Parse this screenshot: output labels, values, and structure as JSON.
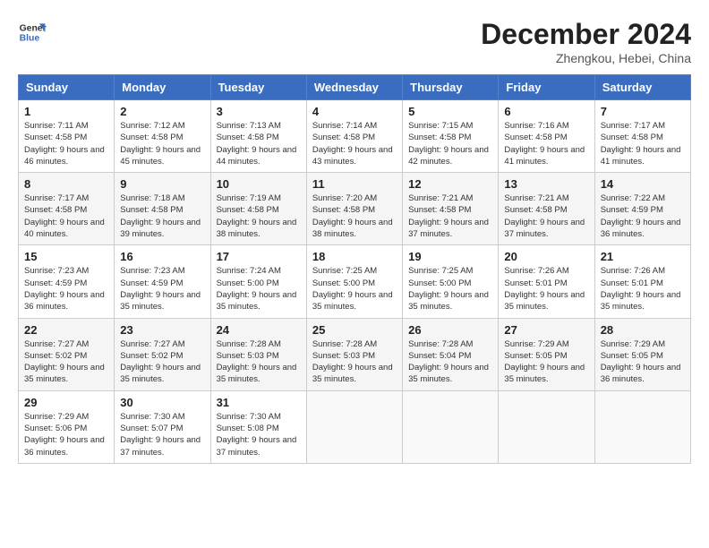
{
  "header": {
    "logo_line1": "General",
    "logo_line2": "Blue",
    "month": "December 2024",
    "location": "Zhengkou, Hebei, China"
  },
  "days_of_week": [
    "Sunday",
    "Monday",
    "Tuesday",
    "Wednesday",
    "Thursday",
    "Friday",
    "Saturday"
  ],
  "weeks": [
    [
      {
        "day": "1",
        "sunrise": "7:11 AM",
        "sunset": "4:58 PM",
        "daylight": "9 hours and 46 minutes."
      },
      {
        "day": "2",
        "sunrise": "7:12 AM",
        "sunset": "4:58 PM",
        "daylight": "9 hours and 45 minutes."
      },
      {
        "day": "3",
        "sunrise": "7:13 AM",
        "sunset": "4:58 PM",
        "daylight": "9 hours and 44 minutes."
      },
      {
        "day": "4",
        "sunrise": "7:14 AM",
        "sunset": "4:58 PM",
        "daylight": "9 hours and 43 minutes."
      },
      {
        "day": "5",
        "sunrise": "7:15 AM",
        "sunset": "4:58 PM",
        "daylight": "9 hours and 42 minutes."
      },
      {
        "day": "6",
        "sunrise": "7:16 AM",
        "sunset": "4:58 PM",
        "daylight": "9 hours and 41 minutes."
      },
      {
        "day": "7",
        "sunrise": "7:17 AM",
        "sunset": "4:58 PM",
        "daylight": "9 hours and 41 minutes."
      }
    ],
    [
      {
        "day": "8",
        "sunrise": "7:17 AM",
        "sunset": "4:58 PM",
        "daylight": "9 hours and 40 minutes."
      },
      {
        "day": "9",
        "sunrise": "7:18 AM",
        "sunset": "4:58 PM",
        "daylight": "9 hours and 39 minutes."
      },
      {
        "day": "10",
        "sunrise": "7:19 AM",
        "sunset": "4:58 PM",
        "daylight": "9 hours and 38 minutes."
      },
      {
        "day": "11",
        "sunrise": "7:20 AM",
        "sunset": "4:58 PM",
        "daylight": "9 hours and 38 minutes."
      },
      {
        "day": "12",
        "sunrise": "7:21 AM",
        "sunset": "4:58 PM",
        "daylight": "9 hours and 37 minutes."
      },
      {
        "day": "13",
        "sunrise": "7:21 AM",
        "sunset": "4:58 PM",
        "daylight": "9 hours and 37 minutes."
      },
      {
        "day": "14",
        "sunrise": "7:22 AM",
        "sunset": "4:59 PM",
        "daylight": "9 hours and 36 minutes."
      }
    ],
    [
      {
        "day": "15",
        "sunrise": "7:23 AM",
        "sunset": "4:59 PM",
        "daylight": "9 hours and 36 minutes."
      },
      {
        "day": "16",
        "sunrise": "7:23 AM",
        "sunset": "4:59 PM",
        "daylight": "9 hours and 35 minutes."
      },
      {
        "day": "17",
        "sunrise": "7:24 AM",
        "sunset": "5:00 PM",
        "daylight": "9 hours and 35 minutes."
      },
      {
        "day": "18",
        "sunrise": "7:25 AM",
        "sunset": "5:00 PM",
        "daylight": "9 hours and 35 minutes."
      },
      {
        "day": "19",
        "sunrise": "7:25 AM",
        "sunset": "5:00 PM",
        "daylight": "9 hours and 35 minutes."
      },
      {
        "day": "20",
        "sunrise": "7:26 AM",
        "sunset": "5:01 PM",
        "daylight": "9 hours and 35 minutes."
      },
      {
        "day": "21",
        "sunrise": "7:26 AM",
        "sunset": "5:01 PM",
        "daylight": "9 hours and 35 minutes."
      }
    ],
    [
      {
        "day": "22",
        "sunrise": "7:27 AM",
        "sunset": "5:02 PM",
        "daylight": "9 hours and 35 minutes."
      },
      {
        "day": "23",
        "sunrise": "7:27 AM",
        "sunset": "5:02 PM",
        "daylight": "9 hours and 35 minutes."
      },
      {
        "day": "24",
        "sunrise": "7:28 AM",
        "sunset": "5:03 PM",
        "daylight": "9 hours and 35 minutes."
      },
      {
        "day": "25",
        "sunrise": "7:28 AM",
        "sunset": "5:03 PM",
        "daylight": "9 hours and 35 minutes."
      },
      {
        "day": "26",
        "sunrise": "7:28 AM",
        "sunset": "5:04 PM",
        "daylight": "9 hours and 35 minutes."
      },
      {
        "day": "27",
        "sunrise": "7:29 AM",
        "sunset": "5:05 PM",
        "daylight": "9 hours and 35 minutes."
      },
      {
        "day": "28",
        "sunrise": "7:29 AM",
        "sunset": "5:05 PM",
        "daylight": "9 hours and 36 minutes."
      }
    ],
    [
      {
        "day": "29",
        "sunrise": "7:29 AM",
        "sunset": "5:06 PM",
        "daylight": "9 hours and 36 minutes."
      },
      {
        "day": "30",
        "sunrise": "7:30 AM",
        "sunset": "5:07 PM",
        "daylight": "9 hours and 37 minutes."
      },
      {
        "day": "31",
        "sunrise": "7:30 AM",
        "sunset": "5:08 PM",
        "daylight": "9 hours and 37 minutes."
      },
      null,
      null,
      null,
      null
    ]
  ]
}
